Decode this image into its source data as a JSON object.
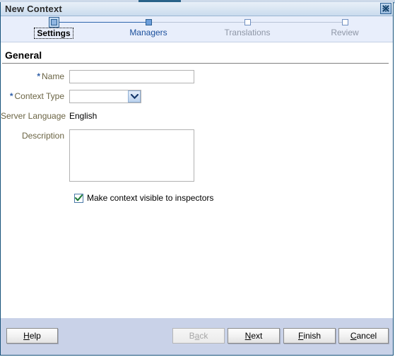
{
  "window": {
    "title": "New Context",
    "close_icon": "close-icon",
    "close_label": "Close"
  },
  "wizard": {
    "steps": [
      {
        "label": "Settings",
        "state": "current"
      },
      {
        "label": "Managers",
        "state": "active"
      },
      {
        "label": "Translations",
        "state": "disabled"
      },
      {
        "label": "Review",
        "state": "disabled"
      }
    ]
  },
  "form": {
    "section_title": "General",
    "required_marker": "*",
    "fields": {
      "name": {
        "label": "Name",
        "value": "",
        "placeholder": "",
        "required": true
      },
      "context_type": {
        "label": "Context Type",
        "value": "",
        "required": true,
        "dropdown_icon": "chevron-down-icon",
        "options": []
      },
      "server_language": {
        "label": "Server Language",
        "value": "English",
        "required": false
      },
      "description": {
        "label": "Description",
        "value": "",
        "placeholder": "",
        "required": false
      }
    },
    "checkbox": {
      "label": "Make context visible to inspectors",
      "checked": true,
      "check_icon": "check-icon"
    }
  },
  "footer": {
    "help": {
      "label": "Help",
      "mnemonic": "H",
      "disabled": false
    },
    "back": {
      "label": "Back",
      "mnemonic": "a",
      "disabled": true
    },
    "next": {
      "label": "Next",
      "mnemonic": "N",
      "disabled": false
    },
    "finish": {
      "label": "Finish",
      "mnemonic": "F",
      "disabled": false
    },
    "cancel": {
      "label": "Cancel",
      "mnemonic": "C",
      "disabled": false
    }
  },
  "colors": {
    "accent": "#2f66ad",
    "required": "#2f5fa8",
    "label": "#6b6444",
    "train_bg": "#e8eefb",
    "footer_bg": "#c9d2e8",
    "border": "#16527a",
    "check": "#1a7a34"
  }
}
